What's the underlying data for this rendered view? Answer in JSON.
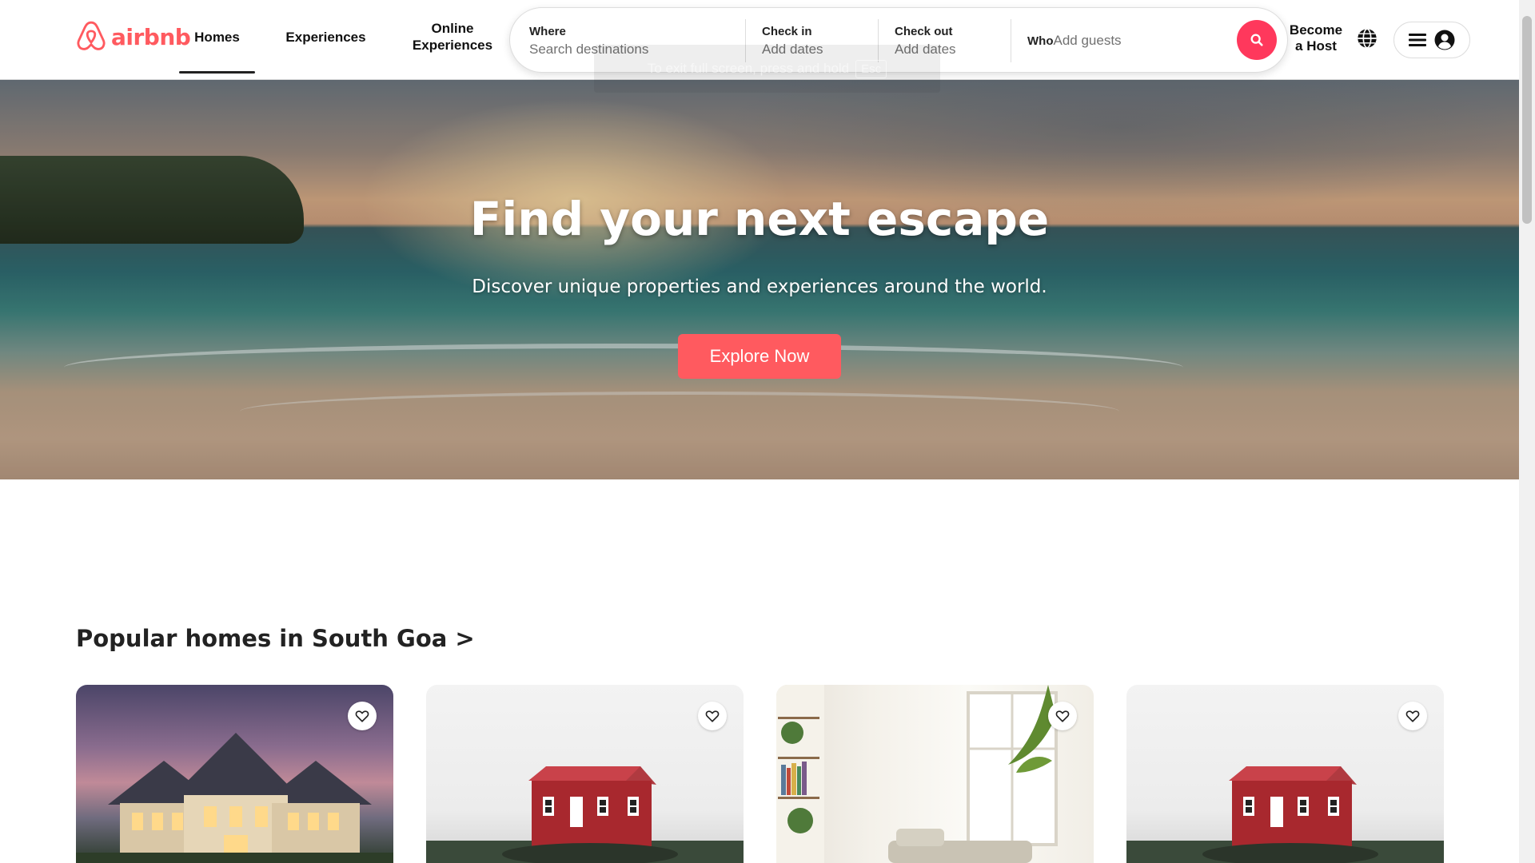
{
  "header": {
    "brand": "airbnb",
    "tabs": [
      {
        "label": "Homes",
        "active": true
      },
      {
        "label": "Experiences",
        "active": false
      },
      {
        "label": "Online Experiences",
        "active": false
      }
    ],
    "search": {
      "where": {
        "label": "Where",
        "placeholder": "Search destinations"
      },
      "check_in": {
        "label": "Check in",
        "value": "Add dates"
      },
      "check_out": {
        "label": "Check out",
        "value": "Add dates"
      },
      "who": {
        "label": "Who",
        "value": "Add guests"
      }
    },
    "fullscreen_notice": {
      "text": "To exit full screen, press and hold",
      "key": "Esc"
    },
    "become_host": "Become a Host",
    "icons": {
      "globe": "globe-icon",
      "menu": "hamburger-icon",
      "user": "user-circle-icon",
      "search": "search-icon"
    }
  },
  "hero": {
    "title": "Find your next escape",
    "subtitle": "Discover unique properties and experiences around the world.",
    "cta": "Explore Now"
  },
  "section": {
    "title": "Popular homes in South Goa >",
    "cards": [
      {
        "image": "lit mansion at dusk",
        "favorite_icon": "heart-outline-icon"
      },
      {
        "image": "red cabin on hill",
        "favorite_icon": "heart-outline-icon"
      },
      {
        "image": "bright living room interior",
        "favorite_icon": "heart-outline-icon"
      },
      {
        "image": "red cabin on hill",
        "favorite_icon": "heart-outline-icon"
      }
    ]
  },
  "colors": {
    "brand": "#ff5a5f",
    "search_button": "#ff385c",
    "text": "#222222",
    "muted": "#717171"
  }
}
